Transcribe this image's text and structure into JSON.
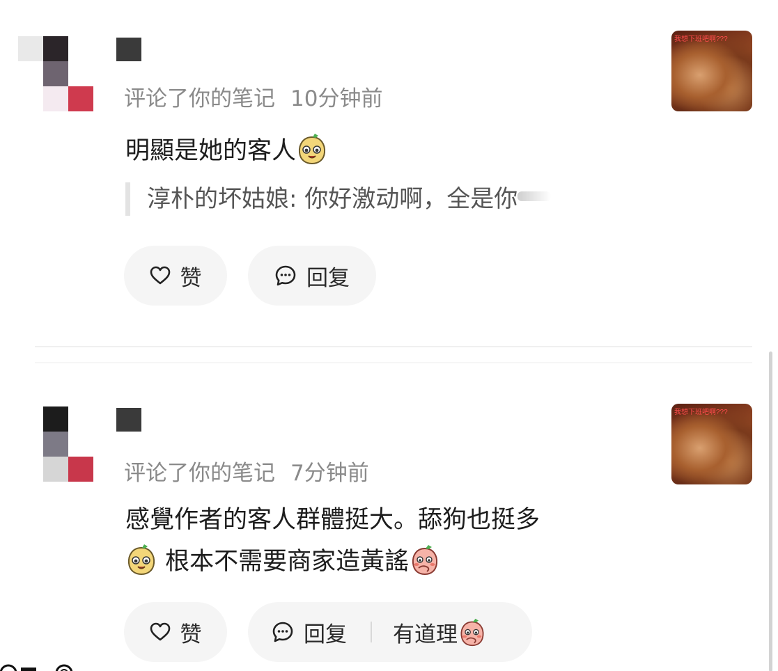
{
  "notifications": [
    {
      "action_text": "评论了你的笔记",
      "time": "10分钟前",
      "comment_text": "明顯是她的客人",
      "quote": {
        "author": "淳朴的坏姑娘",
        "text": "你好激动啊，全是你"
      },
      "like_label": "赞",
      "reply_label": "回复",
      "thumbnail_caption": "我想下班吧啊???"
    },
    {
      "action_text": "评论了你的笔记",
      "time": "7分钟前",
      "comment_line1": "感覺作者的客人群體挺大。舔狗也挺多",
      "comment_line2": "根本不需要商家造黃謠",
      "like_label": "赞",
      "reply_label": "回复",
      "quick_reply_label": "有道理",
      "thumbnail_caption": "我想下班吧啊???"
    }
  ],
  "icons": {
    "like": "heart-outline-icon",
    "reply": "chat-bubble-icon",
    "emoji_1": "grinning-bean-emoji",
    "emoji_2": "blushing-peach-emoji"
  },
  "colors": {
    "meta": "#8a8a8a",
    "pill_bg": "#f5f5f5",
    "avatar_accent": "#c8374b"
  }
}
